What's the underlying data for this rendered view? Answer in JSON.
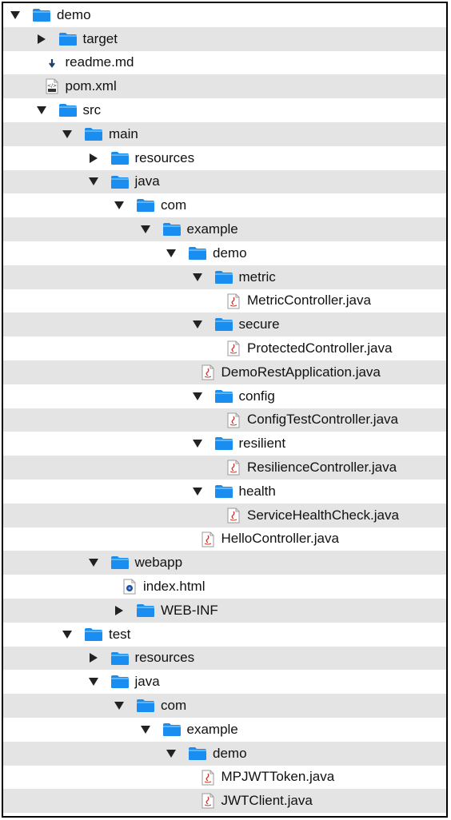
{
  "tree": [
    {
      "label": "demo",
      "depth": 0,
      "type": "folder",
      "expanded": true
    },
    {
      "label": "target",
      "depth": 1,
      "type": "folder",
      "expanded": false
    },
    {
      "label": "readme.md",
      "depth": 1,
      "type": "md"
    },
    {
      "label": "pom.xml",
      "depth": 1,
      "type": "xml"
    },
    {
      "label": "src",
      "depth": 1,
      "type": "folder",
      "expanded": true
    },
    {
      "label": "main",
      "depth": 2,
      "type": "folder",
      "expanded": true
    },
    {
      "label": "resources",
      "depth": 3,
      "type": "folder",
      "expanded": false
    },
    {
      "label": "java",
      "depth": 3,
      "type": "folder",
      "expanded": true
    },
    {
      "label": "com",
      "depth": 4,
      "type": "folder",
      "expanded": true
    },
    {
      "label": "example",
      "depth": 5,
      "type": "folder",
      "expanded": true
    },
    {
      "label": "demo",
      "depth": 6,
      "type": "folder",
      "expanded": true
    },
    {
      "label": "metric",
      "depth": 7,
      "type": "folder",
      "expanded": true
    },
    {
      "label": "MetricController.java",
      "depth": 8,
      "type": "java"
    },
    {
      "label": "secure",
      "depth": 7,
      "type": "folder",
      "expanded": true
    },
    {
      "label": "ProtectedController.java",
      "depth": 8,
      "type": "java"
    },
    {
      "label": "DemoRestApplication.java",
      "depth": 7,
      "type": "java"
    },
    {
      "label": "config",
      "depth": 7,
      "type": "folder",
      "expanded": true
    },
    {
      "label": "ConfigTestController.java",
      "depth": 8,
      "type": "java"
    },
    {
      "label": "resilient",
      "depth": 7,
      "type": "folder",
      "expanded": true
    },
    {
      "label": "ResilienceController.java",
      "depth": 8,
      "type": "java"
    },
    {
      "label": "health",
      "depth": 7,
      "type": "folder",
      "expanded": true
    },
    {
      "label": "ServiceHealthCheck.java",
      "depth": 8,
      "type": "java"
    },
    {
      "label": "HelloController.java",
      "depth": 7,
      "type": "java"
    },
    {
      "label": "webapp",
      "depth": 3,
      "type": "folder",
      "expanded": true
    },
    {
      "label": "index.html",
      "depth": 4,
      "type": "html"
    },
    {
      "label": "WEB-INF",
      "depth": 4,
      "type": "folder",
      "expanded": false
    },
    {
      "label": "test",
      "depth": 2,
      "type": "folder",
      "expanded": true
    },
    {
      "label": "resources",
      "depth": 3,
      "type": "folder",
      "expanded": false
    },
    {
      "label": "java",
      "depth": 3,
      "type": "folder",
      "expanded": true
    },
    {
      "label": "com",
      "depth": 4,
      "type": "folder",
      "expanded": true
    },
    {
      "label": "example",
      "depth": 5,
      "type": "folder",
      "expanded": true
    },
    {
      "label": "demo",
      "depth": 6,
      "type": "folder",
      "expanded": true
    },
    {
      "label": "MPJWTToken.java",
      "depth": 7,
      "type": "java"
    },
    {
      "label": "JWTClient.java",
      "depth": 7,
      "type": "java"
    }
  ],
  "colors": {
    "folder": "#1a8ef0",
    "folder_tab": "#5fb4f6",
    "stripe": "#e4e4e4",
    "java_red": "#c0392b",
    "html_blue": "#1f4f9c",
    "md_arrow": "#1d3f6e"
  },
  "icons": {
    "expanded": "disclosure-down-icon",
    "collapsed": "disclosure-right-icon",
    "folder": "folder-icon",
    "java": "java-file-icon",
    "md": "markdown-file-icon",
    "xml": "xml-file-icon",
    "html": "html-file-icon"
  }
}
